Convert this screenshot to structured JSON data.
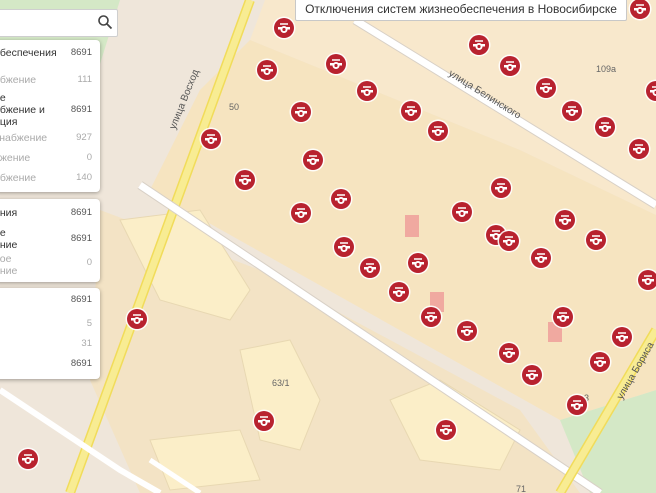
{
  "title": "Отключения систем жизнеобеспечения в Новосибирске",
  "streets": {
    "voskhod": "улица Восход",
    "belinsky": "улица Белинского",
    "borisa": "улица Бориса"
  },
  "buildings": {
    "b50": "50",
    "b109a": "109а",
    "b63_1": "63/1",
    "b71": "71",
    "b3": "3"
  },
  "panel1": {
    "rows": [
      {
        "label": "обеспечения",
        "count": "8691"
      },
      {
        "label": "абжение",
        "count": "111"
      },
      {
        "label": "ое",
        "count": ""
      },
      {
        "label": "абжение и",
        "count": "8691"
      },
      {
        "label": "ация",
        "count": ""
      },
      {
        "label": "снабжение",
        "count": "927"
      },
      {
        "label": "бжение",
        "count": "0"
      },
      {
        "label": "абжение",
        "count": "140"
      }
    ]
  },
  "panel2": {
    "rows": [
      {
        "label": "ения",
        "count": "8691"
      },
      {
        "label": "ое",
        "count": ""
      },
      {
        "label": "ение",
        "count": "8691"
      },
      {
        "label": "ное",
        "count": "0"
      },
      {
        "label": "ение",
        "count": ""
      }
    ]
  },
  "panel3": {
    "rows": [
      {
        "label": "",
        "count": "8691"
      },
      {
        "label": "е",
        "count": "5"
      },
      {
        "label": "е",
        "count": "31"
      },
      {
        "label": "е",
        "count": "8691"
      }
    ]
  },
  "marker_icon": "outage-marker-icon",
  "colors": {
    "marker": "#b8222f",
    "road_major": "#f4e57a",
    "road_minor": "#ffffff",
    "block": "#f7e7c2",
    "park": "#cfe8c2"
  }
}
